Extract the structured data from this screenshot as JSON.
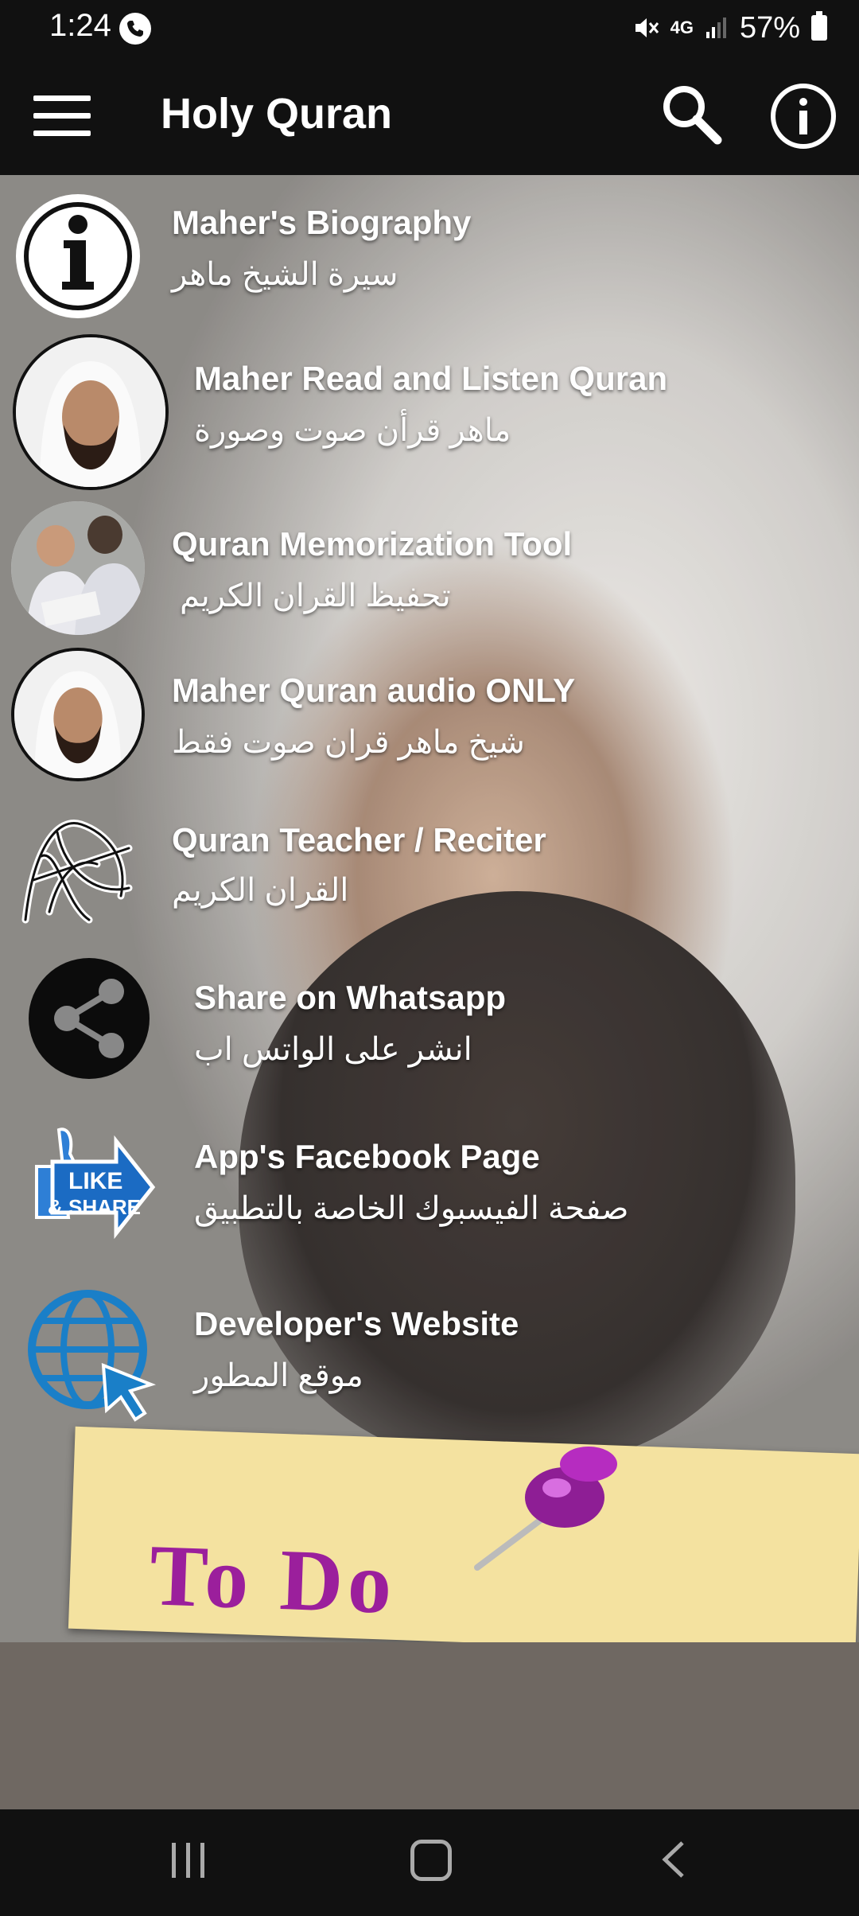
{
  "status_bar": {
    "time": "1:24",
    "network": "4G",
    "battery": "57%"
  },
  "app_bar": {
    "title": "Holy Quran"
  },
  "menu": [
    {
      "icon": "info-icon",
      "title": "Maher's Biography",
      "subtitle": "سيرة الشيخ ماهر"
    },
    {
      "icon": "reciter-avatar",
      "title": "Maher Read and Listen Quran",
      "subtitle": "ماهر قرأن صوت وصورة"
    },
    {
      "icon": "children-reading-photo",
      "title": "Quran Memorization Tool",
      "subtitle": "تحفيظ القران الكريم"
    },
    {
      "icon": "reciter-avatar",
      "title": "Maher Quran audio ONLY",
      "subtitle": "شيخ ماهر قران صوت فقط"
    },
    {
      "icon": "quran-calligraphy-icon",
      "title": "Quran Teacher / Reciter",
      "subtitle": "القران الكريم"
    },
    {
      "icon": "share-icon",
      "title": "Share on Whatsapp",
      "subtitle": "انشر على الواتس اب"
    },
    {
      "icon": "like-share-icon",
      "title": "App's Facebook Page",
      "subtitle": "صفحة الفيسبوك الخاصة بالتطبيق"
    },
    {
      "icon": "globe-cursor-icon",
      "title": "Developer's Website",
      "subtitle": "موقع المطور"
    }
  ],
  "like_badge": {
    "line1": "LIKE",
    "line2": "& SHARE"
  },
  "banner": {
    "text": "To Do"
  },
  "colors": {
    "bar_background": "#111111",
    "text": "#ffffff",
    "banner_text": "#9b1f9c",
    "globe_blue": "#1a7fc8",
    "facebook_blue": "#1b6bc3"
  }
}
